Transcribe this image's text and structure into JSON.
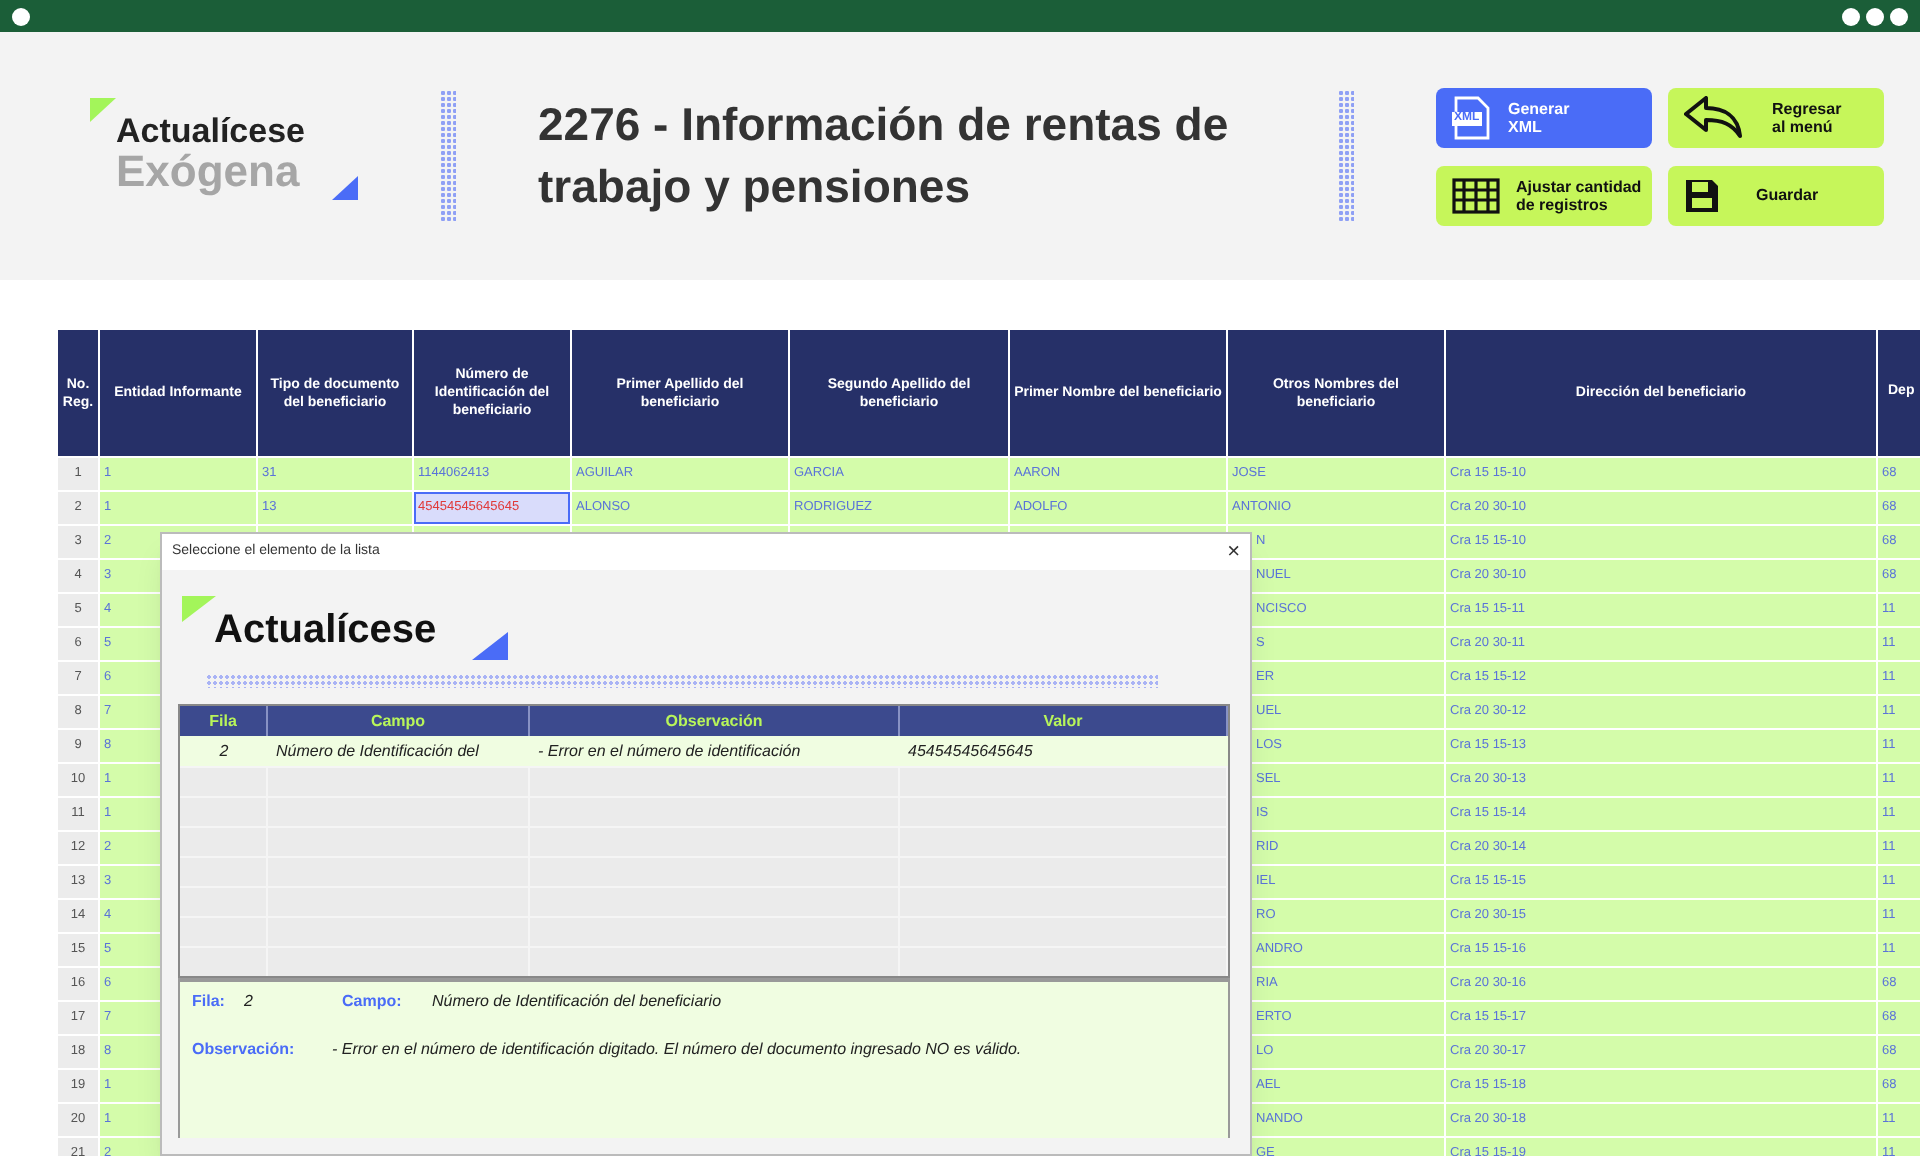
{
  "header": {
    "logo_lines": [
      "Actualícese",
      "Exógena"
    ],
    "title": "2276 - Información de rentas de trabajo y pensiones",
    "buttons": [
      {
        "kind": "xml",
        "label": "Generar XML",
        "icon_text": "XML"
      },
      {
        "kind": "back",
        "label": "Regresar al menú"
      },
      {
        "kind": "grid",
        "label": "Ajustar cantidad de registros"
      },
      {
        "kind": "save",
        "label": "Guardar"
      }
    ]
  },
  "table": {
    "columns": [
      "No. Reg.",
      "Entidad Informante",
      "Tipo de documento del beneficiario",
      "Número de Identificación del beneficiario",
      "Primer Apellido del beneficiario",
      "Segundo Apellido del beneficiario",
      "Primer Nombre del beneficiario",
      "Otros Nombres del beneficiario",
      "Dirección del beneficiario",
      "Dep"
    ],
    "rows": [
      {
        "no": "1",
        "entidad": "1",
        "tipo": "31",
        "numero": "1144062413",
        "numero_selected": false,
        "primer_apellido": "AGUILAR",
        "segundo_apellido": "GARCIA",
        "primer_nombre": "AARON",
        "otros": "JOSE",
        "direccion": "Cra 15 15-10",
        "departamento": "68"
      },
      {
        "no": "2",
        "entidad": "1",
        "tipo": "13",
        "numero": "45454545645645",
        "numero_selected": true,
        "primer_apellido": "ALONSO",
        "segundo_apellido": "RODRIGUEZ",
        "primer_nombre": "ADOLFO",
        "otros": "ANTONIO",
        "direccion": "Cra 20 30-10",
        "departamento": "68"
      },
      {
        "no": "3",
        "entidad": "2",
        "otros": "N",
        "direccion": "Cra 15 15-10",
        "departamento": "68"
      },
      {
        "no": "4",
        "entidad": "3",
        "otros": "NUEL",
        "direccion": "Cra 20 30-10",
        "departamento": "68"
      },
      {
        "no": "5",
        "entidad": "4",
        "otros": "NCISCO",
        "direccion": "Cra 15 15-11",
        "departamento": "11"
      },
      {
        "no": "6",
        "entidad": "5",
        "otros": "S",
        "direccion": "Cra 20 30-11",
        "departamento": "11"
      },
      {
        "no": "7",
        "entidad": "6",
        "otros": "ER",
        "direccion": "Cra 15 15-12",
        "departamento": "11"
      },
      {
        "no": "8",
        "entidad": "7",
        "otros": "UEL",
        "direccion": "Cra 20 30-12",
        "departamento": "11"
      },
      {
        "no": "9",
        "entidad": "8",
        "otros": "LOS",
        "direccion": "Cra 15 15-13",
        "departamento": "11"
      },
      {
        "no": "10",
        "entidad": "1",
        "otros": "SEL",
        "direccion": "Cra 20 30-13",
        "departamento": "11"
      },
      {
        "no": "11",
        "entidad": "1",
        "otros": "IS",
        "direccion": "Cra 15 15-14",
        "departamento": "11"
      },
      {
        "no": "12",
        "entidad": "2",
        "otros": "RID",
        "direccion": "Cra 20 30-14",
        "departamento": "11"
      },
      {
        "no": "13",
        "entidad": "3",
        "otros": "IEL",
        "direccion": "Cra 15 15-15",
        "departamento": "11"
      },
      {
        "no": "14",
        "entidad": "4",
        "otros": "RO",
        "direccion": "Cra 20 30-15",
        "departamento": "11"
      },
      {
        "no": "15",
        "entidad": "5",
        "otros": "ANDRO",
        "direccion": "Cra 15 15-16",
        "departamento": "11"
      },
      {
        "no": "16",
        "entidad": "6",
        "otros": "RIA",
        "direccion": "Cra 20 30-16",
        "departamento": "68"
      },
      {
        "no": "17",
        "entidad": "7",
        "otros": "ERTO",
        "direccion": "Cra 15 15-17",
        "departamento": "68"
      },
      {
        "no": "18",
        "entidad": "8",
        "otros": "LO",
        "direccion": "Cra 20 30-17",
        "departamento": "68"
      },
      {
        "no": "19",
        "entidad": "1",
        "otros": "AEL",
        "direccion": "Cra 15 15-18",
        "departamento": "68"
      },
      {
        "no": "20",
        "entidad": "1",
        "otros": "NANDO",
        "direccion": "Cra 20 30-18",
        "departamento": "11"
      },
      {
        "no": "21",
        "entidad": "2",
        "otros": "GE",
        "direccion": "Cra 15 15-19",
        "departamento": "11"
      }
    ]
  },
  "dialog": {
    "title": "Seleccione el elemento de la lista",
    "close": "×",
    "logo": "Actualícese",
    "list": {
      "columns": [
        "Fila",
        "Campo",
        "Observación",
        "Valor"
      ],
      "rows": [
        {
          "fila": "2",
          "campo": "Número de Identificación del",
          "observacion": "- Error en el número de identificación",
          "valor": "45454545645645"
        }
      ]
    },
    "detail": {
      "fila_label": "Fila:",
      "fila": "2",
      "campo_label": "Campo:",
      "campo": "Número de Identificación del beneficiario",
      "observacion_label": "Observación:",
      "observacion": "- Error en el número de identificación digitado. El número del documento ingresado NO es válido."
    }
  }
}
